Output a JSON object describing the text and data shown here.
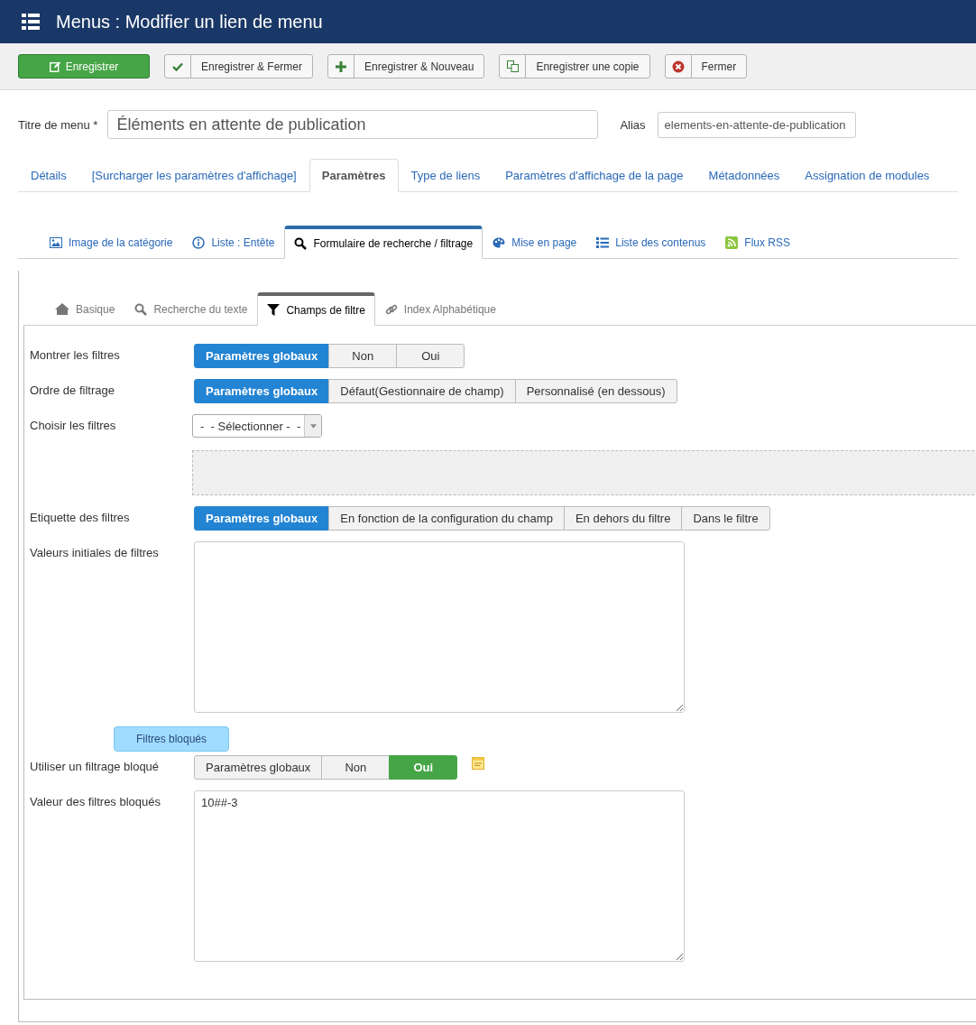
{
  "header": {
    "title": "Menus : Modifier un lien de menu"
  },
  "toolbar": [
    {
      "label": "Enregistrer",
      "kind": "save"
    },
    {
      "label": "Enregistrer & Fermer",
      "kind": "check"
    },
    {
      "label": "Enregistrer & Nouveau",
      "kind": "new"
    },
    {
      "label": "Enregistrer une copie",
      "kind": "copy"
    },
    {
      "label": "Fermer",
      "kind": "close"
    }
  ],
  "title_field": {
    "label": "Titre de menu *",
    "value": "Éléments en attente de publication"
  },
  "alias_field": {
    "label": "Alias",
    "value": "elements-en-attente-de-publication"
  },
  "tabs": [
    {
      "label": "Détails",
      "selected": false
    },
    {
      "label": "[Surcharger les paramètres d'affichage]",
      "selected": false
    },
    {
      "label": "Paramètres",
      "selected": true
    },
    {
      "label": "Type de liens",
      "selected": false
    },
    {
      "label": "Paramètres d'affichage de la page",
      "selected": false
    },
    {
      "label": "Métadonnées",
      "selected": false
    },
    {
      "label": "Assignation de modules",
      "selected": false
    }
  ],
  "subtabs": [
    {
      "label": "Image de la catégorie",
      "kind": "image",
      "selected": false
    },
    {
      "label": "Liste : Entête",
      "kind": "info",
      "selected": false
    },
    {
      "label": "Formulaire de recherche / filtrage",
      "kind": "search",
      "selected": true
    },
    {
      "label": "Mise en page",
      "kind": "palette",
      "selected": false
    },
    {
      "label": "Liste des contenus",
      "kind": "list",
      "selected": false
    },
    {
      "label": "Flux RSS",
      "kind": "rss",
      "selected": false
    }
  ],
  "inner_tabs": [
    {
      "label": "Basique",
      "kind": "home",
      "selected": false
    },
    {
      "label": "Recherche du texte",
      "kind": "search",
      "selected": false
    },
    {
      "label": "Champs de filtre",
      "kind": "filter",
      "selected": true
    },
    {
      "label": "Index Alphabétique",
      "kind": "link",
      "selected": false
    }
  ],
  "fields": [
    {
      "kind": "radio",
      "label": "Montrer les filtres",
      "options": [
        {
          "label": "Paramètres globaux",
          "selected": true,
          "color": "#2384d3"
        },
        {
          "label": "Non",
          "selected": false
        },
        {
          "label": "Oui",
          "selected": false
        }
      ]
    },
    {
      "kind": "radio",
      "label": "Ordre de filtrage",
      "options": [
        {
          "label": "Paramètres globaux",
          "selected": true,
          "color": "#2384d3"
        },
        {
          "label": "Défaut(Gestionnaire de champ)",
          "selected": false
        },
        {
          "label": "Personnalisé (en dessous)",
          "selected": false
        }
      ]
    },
    {
      "kind": "select",
      "label": "Choisir les filtres",
      "value": "-  - Sélectionner -  -"
    },
    {
      "kind": "radio",
      "label": "Etiquette des filtres",
      "options": [
        {
          "label": "Paramètres globaux",
          "selected": true,
          "color": "#2384d3"
        },
        {
          "label": "En fonction de la configuration du champ",
          "selected": false
        },
        {
          "label": "En dehors du filtre",
          "selected": false
        },
        {
          "label": "Dans le filtre",
          "selected": false
        }
      ]
    },
    {
      "kind": "textarea",
      "label": "Valeurs initiales de filtres"
    },
    {
      "kind": "section",
      "label": "Filtres bloqués"
    },
    {
      "kind": "radio",
      "label": "Utiliser un filtrage bloqué",
      "note": true,
      "options": [
        {
          "label": "Paramètres globaux",
          "selected": false
        },
        {
          "label": "Non",
          "selected": false
        },
        {
          "label": "Oui",
          "selected": true,
          "color": "#46a546"
        }
      ]
    },
    {
      "kind": "textarea",
      "label": "Valeur des filtres bloqués",
      "value": "10##-3"
    }
  ]
}
